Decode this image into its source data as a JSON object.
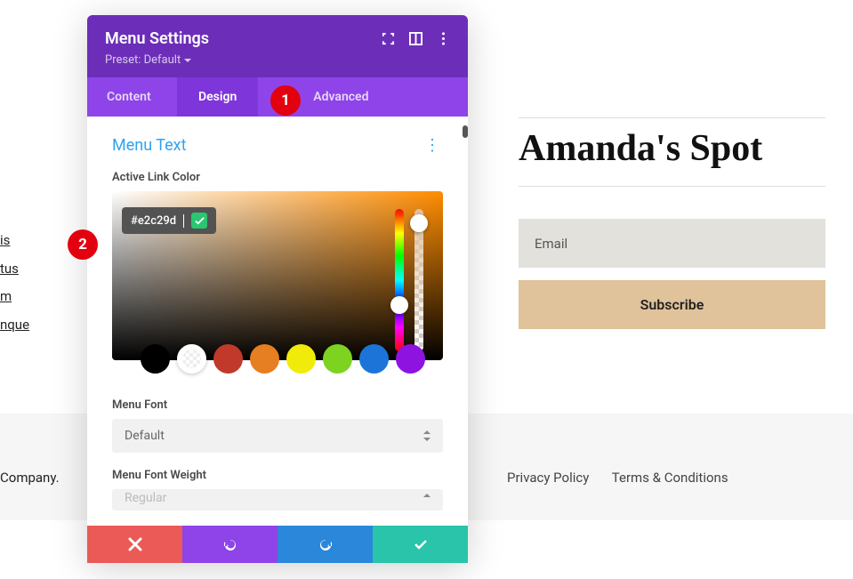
{
  "background": {
    "site_title": "Amanda's Spot",
    "email_placeholder": "Email",
    "subscribe_label": "Subscribe",
    "footer_company": "Company.",
    "footer_links": [
      "Privacy Policy",
      "Terms & Conditions"
    ],
    "left_links": [
      "is",
      "tus",
      "m",
      "nque"
    ]
  },
  "panel": {
    "title": "Menu Settings",
    "preset_label": "Preset: Default",
    "tabs": {
      "content": "Content",
      "design": "Design",
      "advanced": "Advanced"
    },
    "section_title": "Menu Text",
    "active_link_color_label": "Active Link Color",
    "hex_value": "#e2c29d",
    "swatches": [
      "#000000",
      "transparent",
      "#c0392b",
      "#e67e22",
      "#f1eb0a",
      "#7ed321",
      "#1c74d8",
      "#8e12e0"
    ],
    "menu_font_label": "Menu Font",
    "menu_font_value": "Default",
    "menu_font_weight_label": "Menu Font Weight",
    "menu_font_weight_value": "Regular"
  },
  "annotations": {
    "b1": "1",
    "b2": "2"
  }
}
